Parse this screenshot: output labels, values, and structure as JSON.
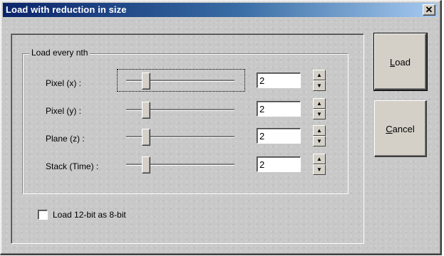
{
  "window": {
    "title": "Load with reduction in size",
    "close_glyph": "✕"
  },
  "group": {
    "legend": "Load every nth"
  },
  "rows": [
    {
      "label": "Pixel (x) :",
      "value": "2"
    },
    {
      "label": "Pixel (y) :",
      "value": "2"
    },
    {
      "label": "Plane (z) :",
      "value": "2"
    },
    {
      "label": "Stack (Time) :",
      "value": "2"
    }
  ],
  "spin": {
    "up_glyph": "▲",
    "down_glyph": "▼"
  },
  "checkbox": {
    "label": "Load 12-bit as 8-bit",
    "checked": false
  },
  "buttons": {
    "load": {
      "mnemonic": "L",
      "rest": "oad"
    },
    "cancel": {
      "mnemonic": "C",
      "rest": "ancel"
    }
  }
}
